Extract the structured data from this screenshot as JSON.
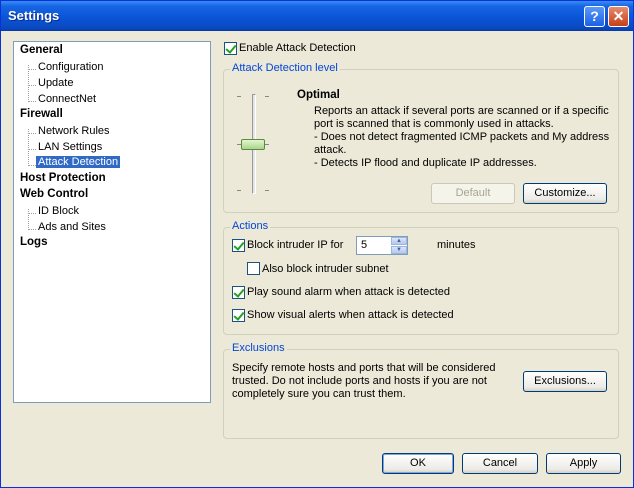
{
  "window": {
    "title": "Settings",
    "help_label": "?",
    "close_label": "✕"
  },
  "tree": {
    "general": "General",
    "configuration": "Configuration",
    "update": "Update",
    "connectnet": "ConnectNet",
    "firewall": "Firewall",
    "network_rules": "Network Rules",
    "lan_settings": "LAN Settings",
    "attack_detection": "Attack Detection",
    "host_protection": "Host Protection",
    "web_control": "Web Control",
    "id_block": "ID Block",
    "ads_sites": "Ads and Sites",
    "logs": "Logs"
  },
  "enable": {
    "label": "Enable Attack Detection",
    "checked": true
  },
  "level": {
    "group_title": "Attack Detection level",
    "name": "Optimal",
    "desc1": "Reports an attack if several ports are scanned or if a specific",
    "desc2": "port is scanned that is commonly used in attacks.",
    "desc3": "- Does not detect fragmented ICMP packets and My address",
    "desc4": "attack.",
    "desc5": "- Detects IP flood and duplicate IP addresses.",
    "default_label": "Default",
    "customize_label": "Customize..."
  },
  "actions": {
    "group_title": "Actions",
    "block_label": "Block intruder IP for",
    "block_value": "5",
    "minutes_label": "minutes",
    "subnet_label": "Also block intruder subnet",
    "sound_label": "Play sound alarm when attack is detected",
    "visual_label": "Show visual alerts when attack is detected"
  },
  "exclusions": {
    "group_title": "Exclusions",
    "line1": "Specify remote hosts and ports that will be considered",
    "line2": "trusted. Do not include ports and hosts if you are not",
    "line3": "completely sure you can trust them.",
    "button_label": "Exclusions..."
  },
  "footer": {
    "ok": "OK",
    "cancel": "Cancel",
    "apply": "Apply"
  },
  "colors": {
    "title_bar": "#0b55d8",
    "group_title": "#0046d5",
    "selection": "#316ac5",
    "check": "#21a121"
  }
}
